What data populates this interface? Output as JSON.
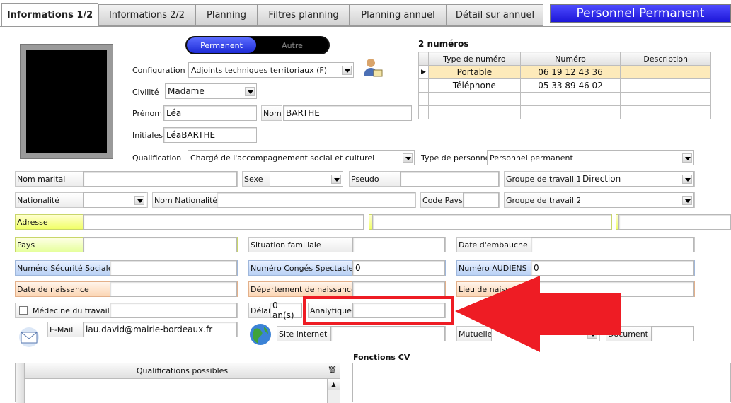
{
  "tabs": [
    "Informations 1/2",
    "Informations 2/2",
    "Planning",
    "Filtres planning",
    "Planning annuel",
    "Détail sur annuel"
  ],
  "window_title": "Personnel Permanent",
  "toggle": {
    "permanent": "Permanent",
    "autre": "Autre"
  },
  "phones": {
    "count_label": "2 numéros",
    "headers": [
      "Type de numéro",
      "Numéro",
      "Description"
    ],
    "rows": [
      [
        "Portable",
        "06 19 12 43 36",
        ""
      ],
      [
        "Téléphone",
        "05 33 89 46 02",
        ""
      ],
      [
        "",
        "",
        ""
      ],
      [
        "",
        "",
        ""
      ]
    ]
  },
  "fields": {
    "configuration": {
      "label": "Configuration",
      "value": "Adjoints techniques territoriaux (F)"
    },
    "civilite": {
      "label": "Civilité",
      "value": "Madame"
    },
    "prenom": {
      "label": "Prénom",
      "value": "Léa"
    },
    "nom": {
      "label": "Nom",
      "value": "BARTHE"
    },
    "initiales": {
      "label": "Initiales",
      "value": "LéaBARTHE"
    },
    "qualification": {
      "label": "Qualification",
      "value": "Chargé de l'accompagnement social et culturel"
    },
    "type_personnel": {
      "label": "Type de personnel",
      "value": "Personnel permanent"
    },
    "nom_marital": {
      "label": "Nom marital",
      "value": ""
    },
    "sexe": {
      "label": "Sexe",
      "value": ""
    },
    "pseudo": {
      "label": "Pseudo",
      "value": ""
    },
    "groupe1": {
      "label": "Groupe de travail 1",
      "value": "Direction"
    },
    "nationalite": {
      "label": "Nationalité",
      "value": ""
    },
    "nom_nationalite": {
      "label": "Nom Nationalité",
      "value": ""
    },
    "code_pays": {
      "label": "Code Pays",
      "value": ""
    },
    "groupe2": {
      "label": "Groupe de travail 2",
      "value": ""
    },
    "adresse": {
      "label": "Adresse",
      "value": ""
    },
    "pays": {
      "label": "Pays",
      "value": ""
    },
    "situation": {
      "label": "Situation familiale",
      "value": ""
    },
    "date_embauche": {
      "label": "Date d'embauche",
      "value": ""
    },
    "secu": {
      "label": "Numéro Sécurité Sociale",
      "value": ""
    },
    "conges": {
      "label": "Numéro Congés Spectacle",
      "value": "0"
    },
    "audiens": {
      "label": "Numéro AUDIENS",
      "value": "0"
    },
    "naissance": {
      "label": "Date de naissance",
      "value": ""
    },
    "dept_naissance": {
      "label": "Département de naissance",
      "value": ""
    },
    "lieu_naissance": {
      "label": "Lieu de naissance",
      "value": ""
    },
    "medecine": {
      "label": "Médecine du travail",
      "value": ""
    },
    "delai": {
      "label": "Délai",
      "value": "0 an(s)"
    },
    "analytique": {
      "label": "Analytique",
      "value": ""
    },
    "email": {
      "label": "E-Mail",
      "value": "lau.david@mairie-bordeaux.fr"
    },
    "site": {
      "label": "Site Internet",
      "value": ""
    },
    "mutuelle": {
      "label": "Mutuelle",
      "value": ""
    },
    "document": {
      "label": "Document",
      "value": ""
    }
  },
  "qualifications": {
    "header": "Qualifications possibles"
  },
  "fonctions_cv": {
    "label": "Fonctions CV"
  },
  "colors": {
    "accent_red": "#ee1c24",
    "title_blue": "#2a24e0"
  }
}
